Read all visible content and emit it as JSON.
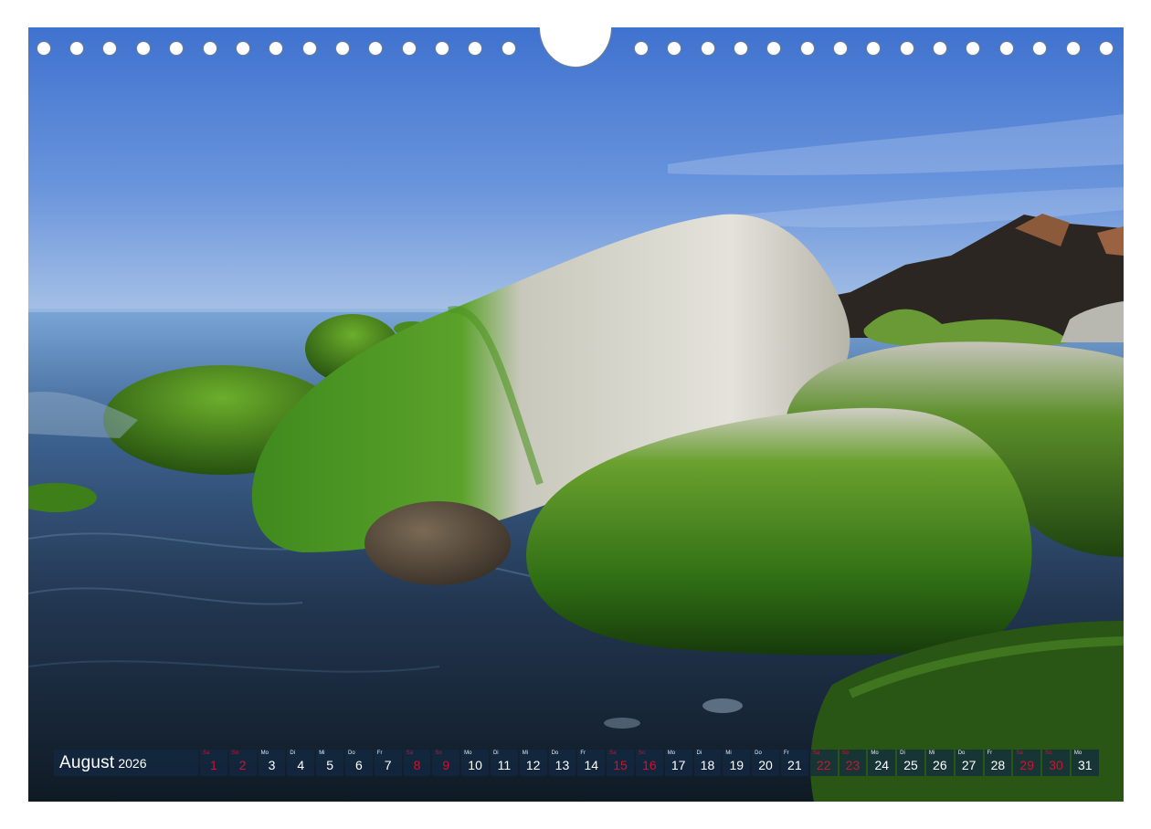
{
  "calendar": {
    "month": "August",
    "year": "2026",
    "days": [
      {
        "wd": "Sa",
        "num": "1",
        "weekend": true
      },
      {
        "wd": "So",
        "num": "2",
        "weekend": true
      },
      {
        "wd": "Mo",
        "num": "3",
        "weekend": false
      },
      {
        "wd": "Di",
        "num": "4",
        "weekend": false
      },
      {
        "wd": "Mi",
        "num": "5",
        "weekend": false
      },
      {
        "wd": "Do",
        "num": "6",
        "weekend": false
      },
      {
        "wd": "Fr",
        "num": "7",
        "weekend": false
      },
      {
        "wd": "Sa",
        "num": "8",
        "weekend": true
      },
      {
        "wd": "So",
        "num": "9",
        "weekend": true
      },
      {
        "wd": "Mo",
        "num": "10",
        "weekend": false
      },
      {
        "wd": "Di",
        "num": "11",
        "weekend": false
      },
      {
        "wd": "Mi",
        "num": "12",
        "weekend": false
      },
      {
        "wd": "Do",
        "num": "13",
        "weekend": false
      },
      {
        "wd": "Fr",
        "num": "14",
        "weekend": false
      },
      {
        "wd": "Sa",
        "num": "15",
        "weekend": true
      },
      {
        "wd": "So",
        "num": "16",
        "weekend": true
      },
      {
        "wd": "Mo",
        "num": "17",
        "weekend": false
      },
      {
        "wd": "Di",
        "num": "18",
        "weekend": false
      },
      {
        "wd": "Mi",
        "num": "19",
        "weekend": false
      },
      {
        "wd": "Do",
        "num": "20",
        "weekend": false
      },
      {
        "wd": "Fr",
        "num": "21",
        "weekend": false
      },
      {
        "wd": "Sa",
        "num": "22",
        "weekend": true
      },
      {
        "wd": "So",
        "num": "23",
        "weekend": true
      },
      {
        "wd": "Mo",
        "num": "24",
        "weekend": false
      },
      {
        "wd": "Di",
        "num": "25",
        "weekend": false
      },
      {
        "wd": "Mi",
        "num": "26",
        "weekend": false
      },
      {
        "wd": "Do",
        "num": "27",
        "weekend": false
      },
      {
        "wd": "Fr",
        "num": "28",
        "weekend": false
      },
      {
        "wd": "Sa",
        "num": "29",
        "weekend": true
      },
      {
        "wd": "So",
        "num": "30",
        "weekend": true
      },
      {
        "wd": "Mo",
        "num": "31",
        "weekend": false
      }
    ]
  },
  "colors": {
    "weekend": "#d0122d",
    "bar": "#122842"
  }
}
